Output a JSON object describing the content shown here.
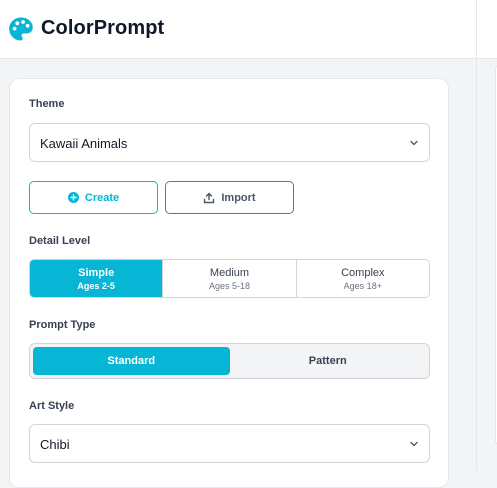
{
  "header": {
    "app_title": "ColorPrompt",
    "logo_icon": "palette-icon",
    "accent_color": "#06b6d4"
  },
  "form": {
    "theme": {
      "label": "Theme",
      "value": "Kawaii Animals"
    },
    "actions": {
      "create_label": "Create",
      "create_icon": "plus-circle-icon",
      "import_label": "Import",
      "import_icon": "upload-icon"
    },
    "detail_level": {
      "label": "Detail Level",
      "options": [
        {
          "title": "Simple",
          "subtitle": "Ages 2-5",
          "selected": true
        },
        {
          "title": "Medium",
          "subtitle": "Ages 5-18",
          "selected": false
        },
        {
          "title": "Complex",
          "subtitle": "Ages 18+",
          "selected": false
        }
      ]
    },
    "prompt_type": {
      "label": "Prompt Type",
      "options": [
        {
          "title": "Standard",
          "selected": true
        },
        {
          "title": "Pattern",
          "selected": false
        }
      ]
    },
    "art_style": {
      "label": "Art Style",
      "value": "Chibi"
    }
  }
}
